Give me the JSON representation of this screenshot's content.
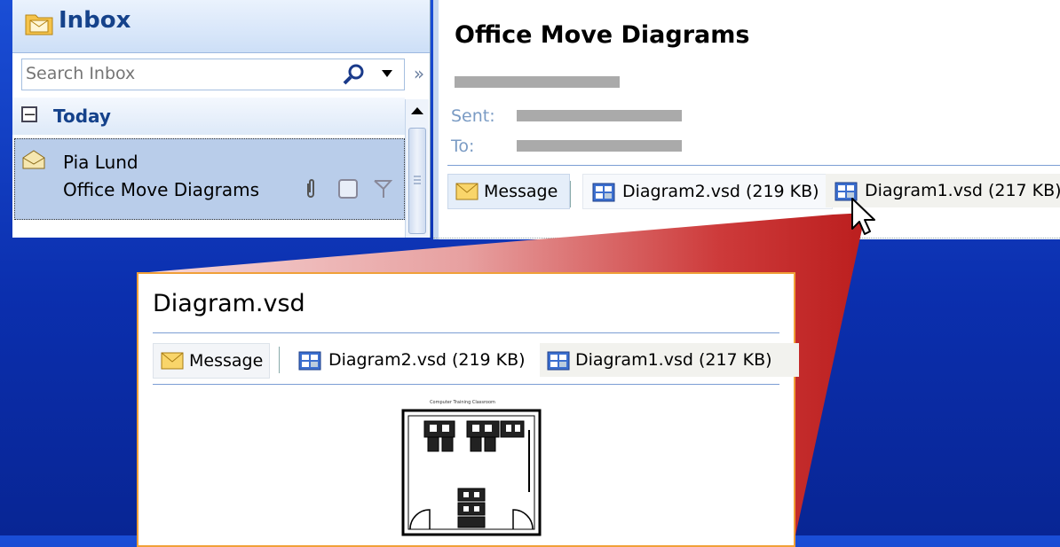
{
  "inbox": {
    "title": "Inbox",
    "search_placeholder": "Search Inbox",
    "group_label": "Today",
    "group_toggle": "−",
    "expand_glyph": "»",
    "message": {
      "sender": "Pia Lund",
      "subject": "Office Move Diagrams"
    }
  },
  "reading": {
    "subject": "Office Move Diagrams",
    "sent_label": "Sent:",
    "to_label": "To:",
    "attachments": {
      "message_label": "Message",
      "file2": "Diagram2.vsd (219 KB)",
      "file1": "Diagram1.vsd (217 KB)"
    }
  },
  "zoom": {
    "title": "Diagram.vsd",
    "attachments": {
      "message_label": "Message",
      "file2": "Diagram2.vsd (219 KB)",
      "file1": "Diagram1.vsd (217 KB)"
    },
    "diagram_caption": "Computer Training Classroom"
  },
  "colors": {
    "background_blue": "#0b2fae",
    "header_text": "#15428b",
    "selected_row": "#b9cdea",
    "zoom_border": "#f0a038",
    "wedge_red": "#c0201e"
  },
  "icons": {
    "inbox": "folder-envelope-icon",
    "search": "magnifier-icon",
    "attachment": "paperclip-icon",
    "flag": "flag-icon",
    "visio_file": "visio-file-icon",
    "message": "envelope-icon",
    "cursor": "arrow-cursor-icon"
  }
}
